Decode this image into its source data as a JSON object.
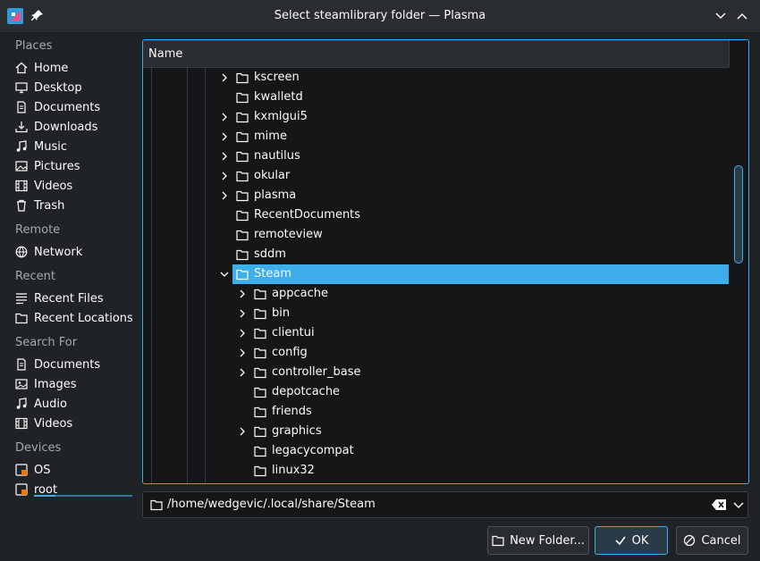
{
  "window": {
    "title": "Select steamlibrary folder — Plasma"
  },
  "sidebar": {
    "places_header": "Places",
    "places": [
      {
        "label": "Home",
        "icon": "home-icon"
      },
      {
        "label": "Desktop",
        "icon": "desktop-icon"
      },
      {
        "label": "Documents",
        "icon": "documents-icon"
      },
      {
        "label": "Downloads",
        "icon": "downloads-icon"
      },
      {
        "label": "Music",
        "icon": "music-icon"
      },
      {
        "label": "Pictures",
        "icon": "pictures-icon"
      },
      {
        "label": "Videos",
        "icon": "videos-icon"
      },
      {
        "label": "Trash",
        "icon": "trash-icon"
      }
    ],
    "remote_header": "Remote",
    "remote": [
      {
        "label": "Network",
        "icon": "network-icon"
      }
    ],
    "recent_header": "Recent",
    "recent": [
      {
        "label": "Recent Files",
        "icon": "recent-files-icon"
      },
      {
        "label": "Recent Locations",
        "icon": "recent-locations-icon"
      }
    ],
    "search_header": "Search For",
    "search": [
      {
        "label": "Documents",
        "icon": "documents-icon"
      },
      {
        "label": "Images",
        "icon": "images-icon"
      },
      {
        "label": "Audio",
        "icon": "audio-icon"
      },
      {
        "label": "Videos",
        "icon": "videos-icon"
      }
    ],
    "devices_header": "Devices",
    "devices": [
      {
        "label": "OS",
        "icon": "drive-icon"
      },
      {
        "label": "root",
        "icon": "drive-icon"
      }
    ]
  },
  "tree": {
    "column_header": "Name",
    "rows": [
      {
        "name": "kscreen",
        "expandable": true,
        "expanded": false,
        "level": 0
      },
      {
        "name": "kwalletd",
        "expandable": false,
        "expanded": false,
        "level": 0
      },
      {
        "name": "kxmlgui5",
        "expandable": true,
        "expanded": false,
        "level": 0
      },
      {
        "name": "mime",
        "expandable": true,
        "expanded": false,
        "level": 0
      },
      {
        "name": "nautilus",
        "expandable": true,
        "expanded": false,
        "level": 0
      },
      {
        "name": "okular",
        "expandable": true,
        "expanded": false,
        "level": 0
      },
      {
        "name": "plasma",
        "expandable": true,
        "expanded": false,
        "level": 0
      },
      {
        "name": "RecentDocuments",
        "expandable": false,
        "expanded": false,
        "level": 0
      },
      {
        "name": "remoteview",
        "expandable": false,
        "expanded": false,
        "level": 0
      },
      {
        "name": "sddm",
        "expandable": false,
        "expanded": false,
        "level": 0
      },
      {
        "name": "Steam",
        "expandable": true,
        "expanded": true,
        "level": 0,
        "selected": true
      },
      {
        "name": "appcache",
        "expandable": true,
        "expanded": false,
        "level": 1
      },
      {
        "name": "bin",
        "expandable": true,
        "expanded": false,
        "level": 1
      },
      {
        "name": "clientui",
        "expandable": true,
        "expanded": false,
        "level": 1
      },
      {
        "name": "config",
        "expandable": true,
        "expanded": false,
        "level": 1
      },
      {
        "name": "controller_base",
        "expandable": true,
        "expanded": false,
        "level": 1
      },
      {
        "name": "depotcache",
        "expandable": false,
        "expanded": false,
        "level": 1
      },
      {
        "name": "friends",
        "expandable": false,
        "expanded": false,
        "level": 1
      },
      {
        "name": "graphics",
        "expandable": true,
        "expanded": false,
        "level": 1
      },
      {
        "name": "legacycompat",
        "expandable": false,
        "expanded": false,
        "level": 1
      },
      {
        "name": "linux32",
        "expandable": false,
        "expanded": false,
        "level": 1
      }
    ]
  },
  "pathbar": {
    "value": "/home/wedgevic/.local/share/Steam"
  },
  "buttons": {
    "new_folder": "New Folder...",
    "ok": "OK",
    "cancel": "Cancel"
  },
  "colors": {
    "accent": "#3daee9",
    "background": "#202326",
    "view_background": "#141618"
  }
}
